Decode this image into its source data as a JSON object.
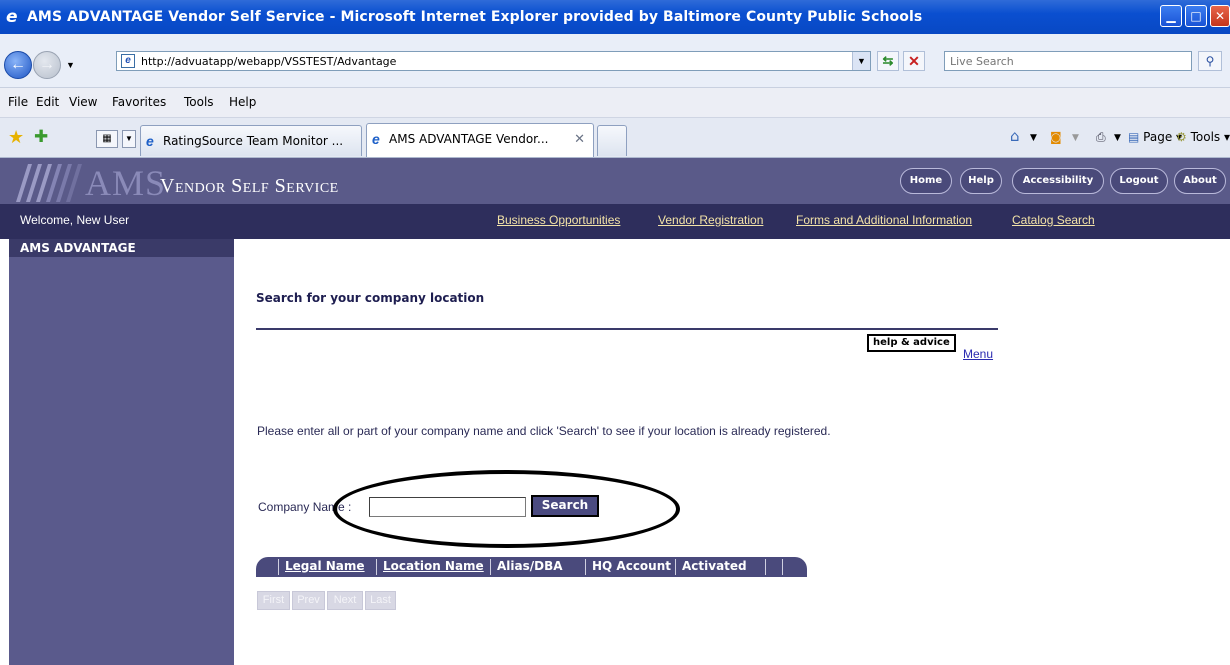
{
  "window": {
    "title": "AMS ADVANTAGE Vendor Self Service - Microsoft Internet Explorer provided by Baltimore County Public Schools"
  },
  "browser": {
    "address_url": "http://advuatapp/webapp/VSSTEST/Advantage",
    "live_search_placeholder": "Live Search",
    "menu": [
      "File",
      "Edit",
      "View",
      "Favorites",
      "Tools",
      "Help"
    ],
    "tabs": [
      {
        "label": "RatingSource Team Monitor ...",
        "active": false
      },
      {
        "label": "AMS ADVANTAGE Vendor...",
        "active": true
      }
    ],
    "commands": {
      "page": "Page",
      "tools": "Tools"
    }
  },
  "app": {
    "logo_ams": "AMS",
    "logo_product": "Vendor Self Service",
    "header_buttons": [
      "Home",
      "Help",
      "Accessibility",
      "Logout",
      "About"
    ],
    "welcome": "Welcome, New User",
    "nav_links": [
      "Business Opportunities",
      "Vendor Registration",
      "Forms and Additional Information",
      "Catalog Search"
    ],
    "sidebar_heading": "AMS ADVANTAGE"
  },
  "main": {
    "title": "Search for your company location",
    "help_advice": "help & advice",
    "menu_link": "Menu",
    "instructions": "Please enter all or part of your company name and click 'Search' to see if your location is already registered.",
    "company_name_label": "Company Name :",
    "company_name_value": "",
    "search_button": "Search",
    "grid_columns": [
      {
        "label": "Legal Name",
        "sortable": true
      },
      {
        "label": "Location Name",
        "sortable": true
      },
      {
        "label": "Alias/DBA",
        "sortable": false
      },
      {
        "label": "HQ Account",
        "sortable": false
      },
      {
        "label": "Activated",
        "sortable": false
      }
    ],
    "pager": [
      "First",
      "Prev",
      "Next",
      "Last"
    ]
  },
  "colors": {
    "header_bg": "#5a5a89",
    "navbar_bg": "#2e2e5c",
    "sidebar_bg": "#5a5a8c",
    "nav_link": "#f4e4a8"
  }
}
